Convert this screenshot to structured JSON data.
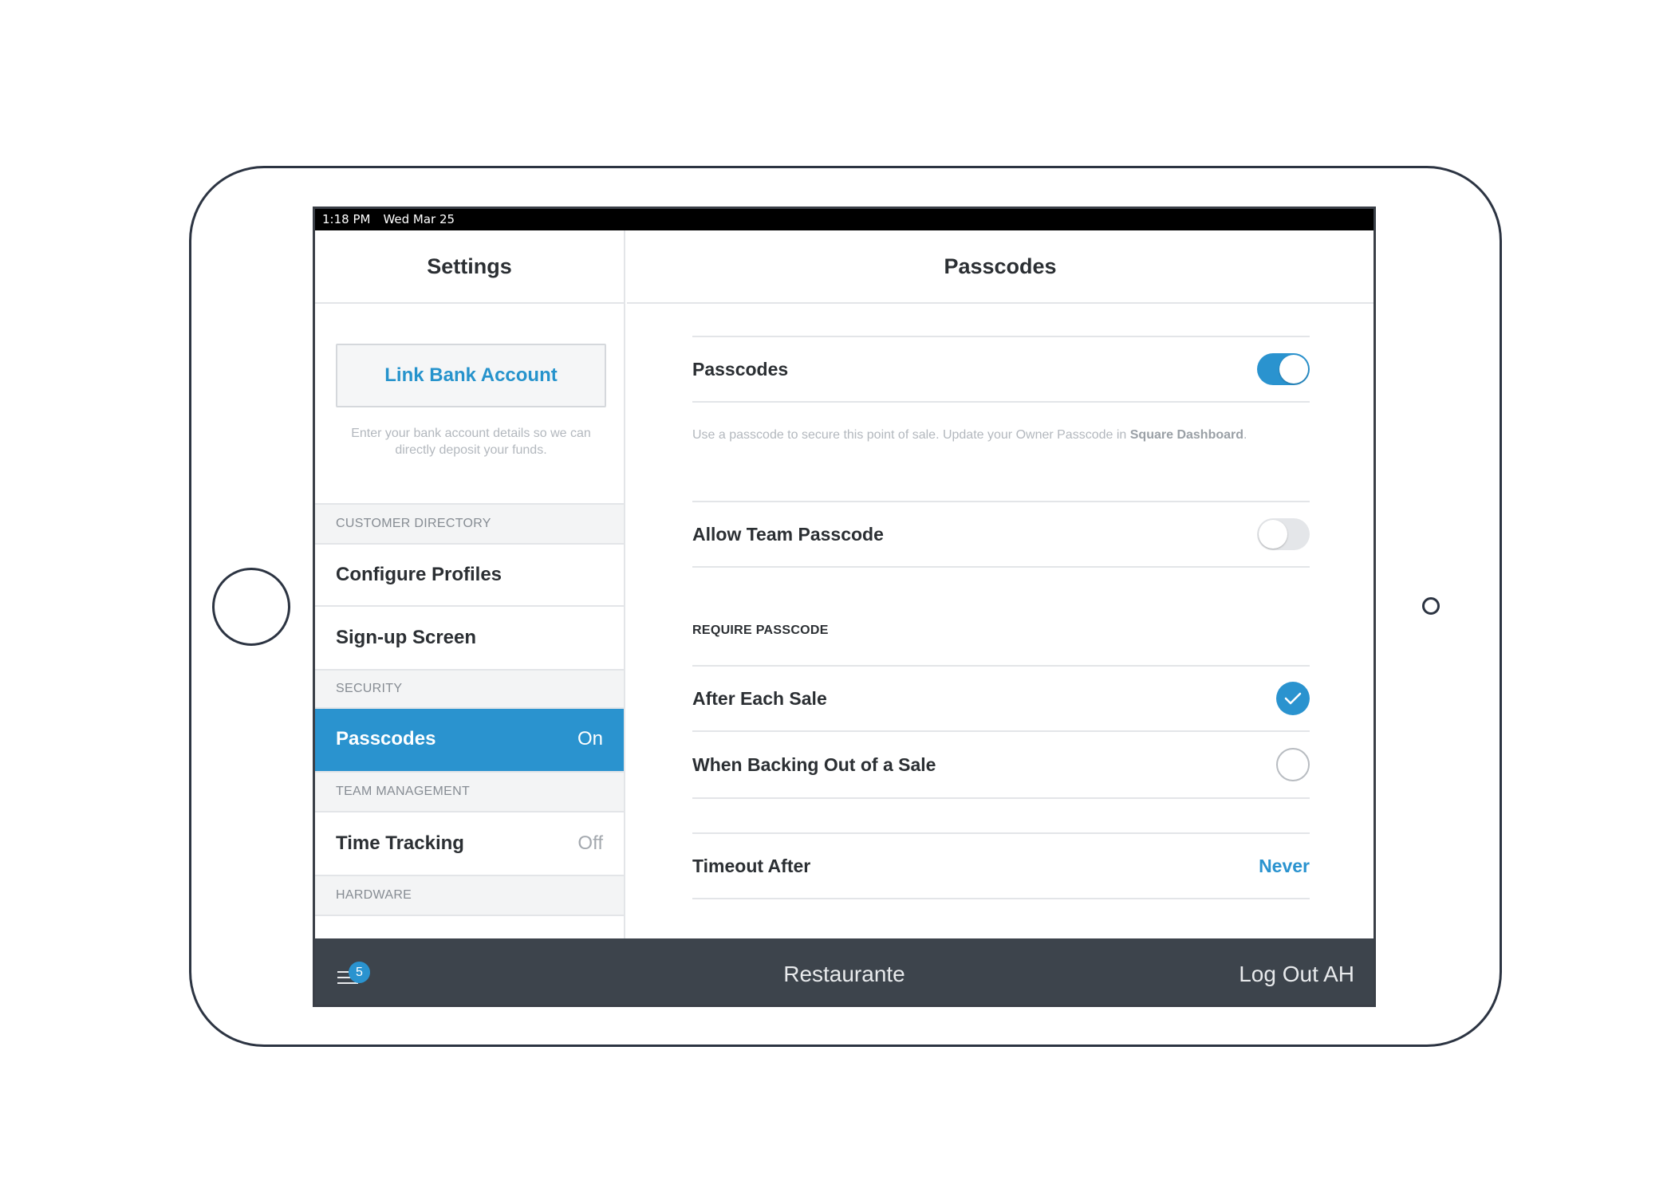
{
  "status_bar": {
    "time": "1:18 PM",
    "date": "Wed Mar 25"
  },
  "sidebar": {
    "title": "Settings",
    "link_bank_label": "Link Bank Account",
    "bank_hint": "Enter your bank account details so we can directly deposit your funds.",
    "sections": [
      {
        "header": "CUSTOMER DIRECTORY",
        "items": [
          {
            "label": "Configure Profiles",
            "value": ""
          },
          {
            "label": "Sign-up Screen",
            "value": ""
          }
        ]
      },
      {
        "header": "SECURITY",
        "items": [
          {
            "label": "Passcodes",
            "value": "On",
            "active": true
          }
        ]
      },
      {
        "header": "TEAM MANAGEMENT",
        "items": [
          {
            "label": "Time Tracking",
            "value": "Off"
          }
        ]
      },
      {
        "header": "HARDWARE",
        "items": []
      }
    ]
  },
  "main": {
    "title": "Passcodes",
    "passcodes_label": "Passcodes",
    "passcodes_enabled": true,
    "hint_prefix": "Use a passcode to secure this point of sale. Update your Owner Passcode in ",
    "hint_link": "Square Dashboard",
    "hint_suffix": ".",
    "team_passcode_label": "Allow Team Passcode",
    "team_passcode_enabled": false,
    "require_header": "REQUIRE PASSCODE",
    "options": [
      {
        "label": "After Each Sale",
        "checked": true
      },
      {
        "label": "When Backing Out of a Sale",
        "checked": false
      }
    ],
    "timeout_label": "Timeout After",
    "timeout_value": "Never"
  },
  "bottom_bar": {
    "badge_count": "5",
    "location": "Restaurante",
    "logout_label": "Log Out AH"
  },
  "colors": {
    "accent": "#2a93cf",
    "bottom_bar": "#3d444c",
    "frame": "#2c3442"
  }
}
